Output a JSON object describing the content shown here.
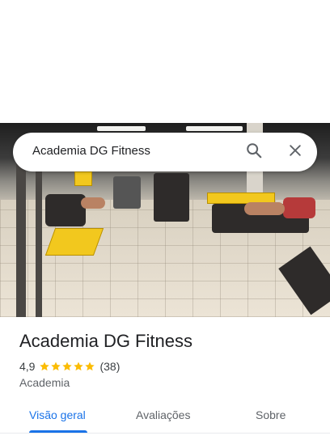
{
  "search": {
    "query": "Academia DG Fitness"
  },
  "icons": {
    "search": "search-icon",
    "close": "close-icon",
    "star": "star-icon"
  },
  "place": {
    "name": "Academia DG Fitness",
    "rating": "4,9",
    "stars_filled": 5,
    "reviews": "(38)",
    "category": "Academia"
  },
  "tabs": [
    {
      "label": "Visão geral",
      "active": true
    },
    {
      "label": "Avaliações",
      "active": false
    },
    {
      "label": "Sobre",
      "active": false
    }
  ],
  "colors": {
    "accent": "#1a73e8",
    "star": "#fbbc04",
    "text_primary": "#202124",
    "text_secondary": "#5f6368"
  }
}
